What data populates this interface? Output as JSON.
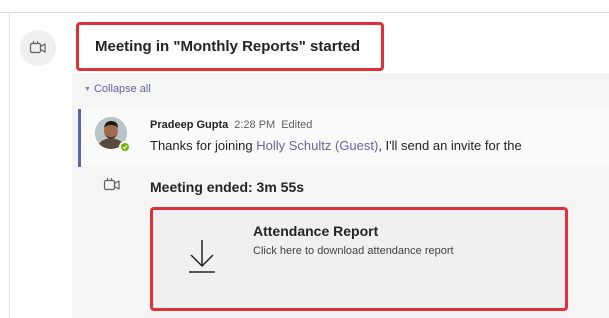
{
  "header": {
    "title": "Meeting in \"Monthly Reports\" started",
    "icon": "meeting-camera-icon"
  },
  "thread": {
    "collapse_label": "Collapse all"
  },
  "message": {
    "author": "Pradeep Gupta",
    "time": "2:28 PM",
    "edited": "Edited",
    "text_before": "Thanks for joining ",
    "mention": "Holly Schultz (Guest)",
    "text_after": ", I'll send an invite for the",
    "presence": "available",
    "presence_color": "#6bb700"
  },
  "meeting_end": {
    "label": "Meeting ended: 3m 55s",
    "icon": "meeting-camera-icon"
  },
  "attendance_card": {
    "title": "Attendance Report",
    "subtitle": "Click here to download attendance report",
    "icon": "download-arrow-icon"
  },
  "colors": {
    "accent": "#6264a7",
    "highlight": "#e0303c"
  }
}
